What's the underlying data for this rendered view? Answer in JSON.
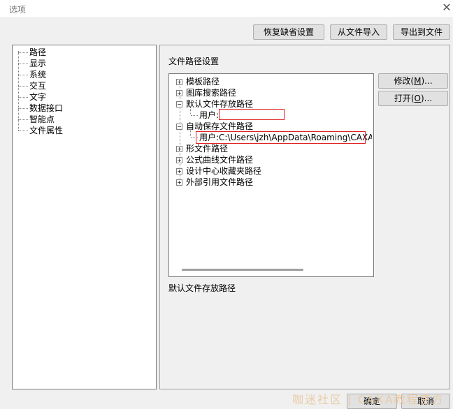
{
  "window": {
    "title": "选项",
    "close_glyph": "✕"
  },
  "toolbar": {
    "restore_defaults": "恢复缺省设置",
    "import_from_file": "从文件导入",
    "export_to_file": "导出到文件"
  },
  "sidebar": {
    "items": [
      "路径",
      "显示",
      "系统",
      "交互",
      "文字",
      "数据接口",
      "智能点",
      "文件属性"
    ]
  },
  "main": {
    "group_title": "文件路径设置",
    "tree": [
      {
        "label": "模板路径",
        "expander": "+"
      },
      {
        "label": "图库搜索路径",
        "expander": "+"
      },
      {
        "label": "默认文件存放路径",
        "expander": "−"
      },
      {
        "label": "用户:",
        "child": true
      },
      {
        "label": "自动保存文件路径",
        "expander": "−"
      },
      {
        "label": "用户:C:\\Users\\jzh\\AppData\\Roaming\\CAXA\\CAXA C",
        "child": true
      },
      {
        "label": "形文件路径",
        "expander": "+"
      },
      {
        "label": "公式曲线文件路径",
        "expander": "+"
      },
      {
        "label": "设计中心收藏夹路径",
        "expander": "+"
      },
      {
        "label": "外部引用文件路径",
        "expander": "+"
      }
    ],
    "modify_label": "修改(",
    "modify_key": "M",
    "modify_suffix": ")...",
    "open_label": "打开(",
    "open_key": "O",
    "open_suffix": ")...",
    "description": "默认文件存放路径"
  },
  "footer": {
    "ok": "确定",
    "cancel": "取消",
    "watermark": "咖迷社区 | CAXA教程官方"
  },
  "colors": {
    "highlight": "#e02020",
    "panel_bg": "#ffffff",
    "dialog_bg": "#f0f0f0"
  }
}
